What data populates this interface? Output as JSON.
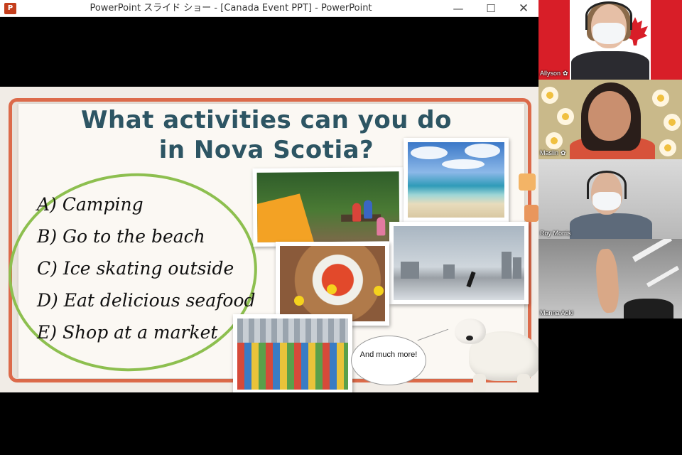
{
  "window": {
    "title": "PowerPoint スライド ショー - [Canada Event PPT] - PowerPoint",
    "app_icon": "P",
    "controls": {
      "minimize": "—",
      "maximize": "☐",
      "close": "✕"
    }
  },
  "slide": {
    "title": "What activities can you do in Nova Scotia?",
    "answers": [
      "A) Camping",
      "B) Go to the beach",
      "C) Ice skating outside",
      "D) Eat delicious seafood",
      "E) Shop at a market"
    ],
    "speech_bubble": "And much more!",
    "colors": {
      "frame": "#dc6a4a",
      "title": "#2d5563",
      "circle": "#8dbf4f"
    }
  },
  "participants": [
    {
      "name": "Allyson",
      "mic": "✿"
    },
    {
      "name": "Maslin",
      "mic": "✿"
    },
    {
      "name": "Roy Morris",
      "mic": ""
    },
    {
      "name": "Manna Aoki",
      "mic": ""
    }
  ]
}
